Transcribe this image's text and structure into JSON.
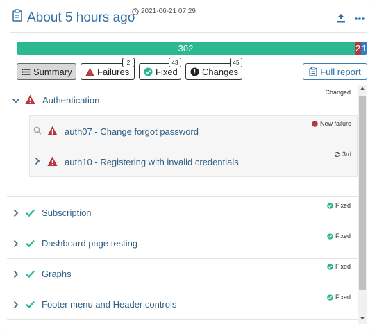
{
  "header": {
    "title": "About 5 hours ago",
    "timestamp": "2021-06-21 07:29",
    "title_icon": "clipboard-icon",
    "actions": [
      "upload-icon",
      "more-icon"
    ]
  },
  "progress": {
    "passed": 302,
    "failed": 2,
    "changed": 1,
    "colors": {
      "passed": "#2bb893",
      "failed": "#b5383a",
      "changed": "#2f7fc4"
    }
  },
  "tabs": [
    {
      "label": "Summary",
      "icon": "list-icon"
    },
    {
      "label": "Failures",
      "icon": "warning-icon",
      "badge": "2"
    },
    {
      "label": "Fixed",
      "icon": "check-circle-icon",
      "badge": "43"
    },
    {
      "label": "Changes",
      "icon": "exclamation-circle-icon",
      "badge": "45"
    }
  ],
  "full_report": {
    "label": "Full report",
    "icon": "clipboard-icon"
  },
  "groups": [
    {
      "label": "Authentication",
      "tag": "Changed",
      "status": "warning",
      "expanded": true,
      "children": [
        {
          "label": "auth07 - Change forgot password",
          "tag": "New failure",
          "status": "warning"
        },
        {
          "label": "auth10 - Registering with invalid credentials",
          "tag": "3rd",
          "status": "warning"
        }
      ]
    },
    {
      "label": "Subscription",
      "tag": "Fixed",
      "status": "fixed"
    },
    {
      "label": "Dashboard page testing",
      "tag": "Fixed",
      "status": "fixed"
    },
    {
      "label": "Graphs",
      "tag": "Fixed",
      "status": "fixed"
    },
    {
      "label": "Footer menu and Header controls",
      "tag": "Fixed",
      "status": "fixed"
    }
  ]
}
